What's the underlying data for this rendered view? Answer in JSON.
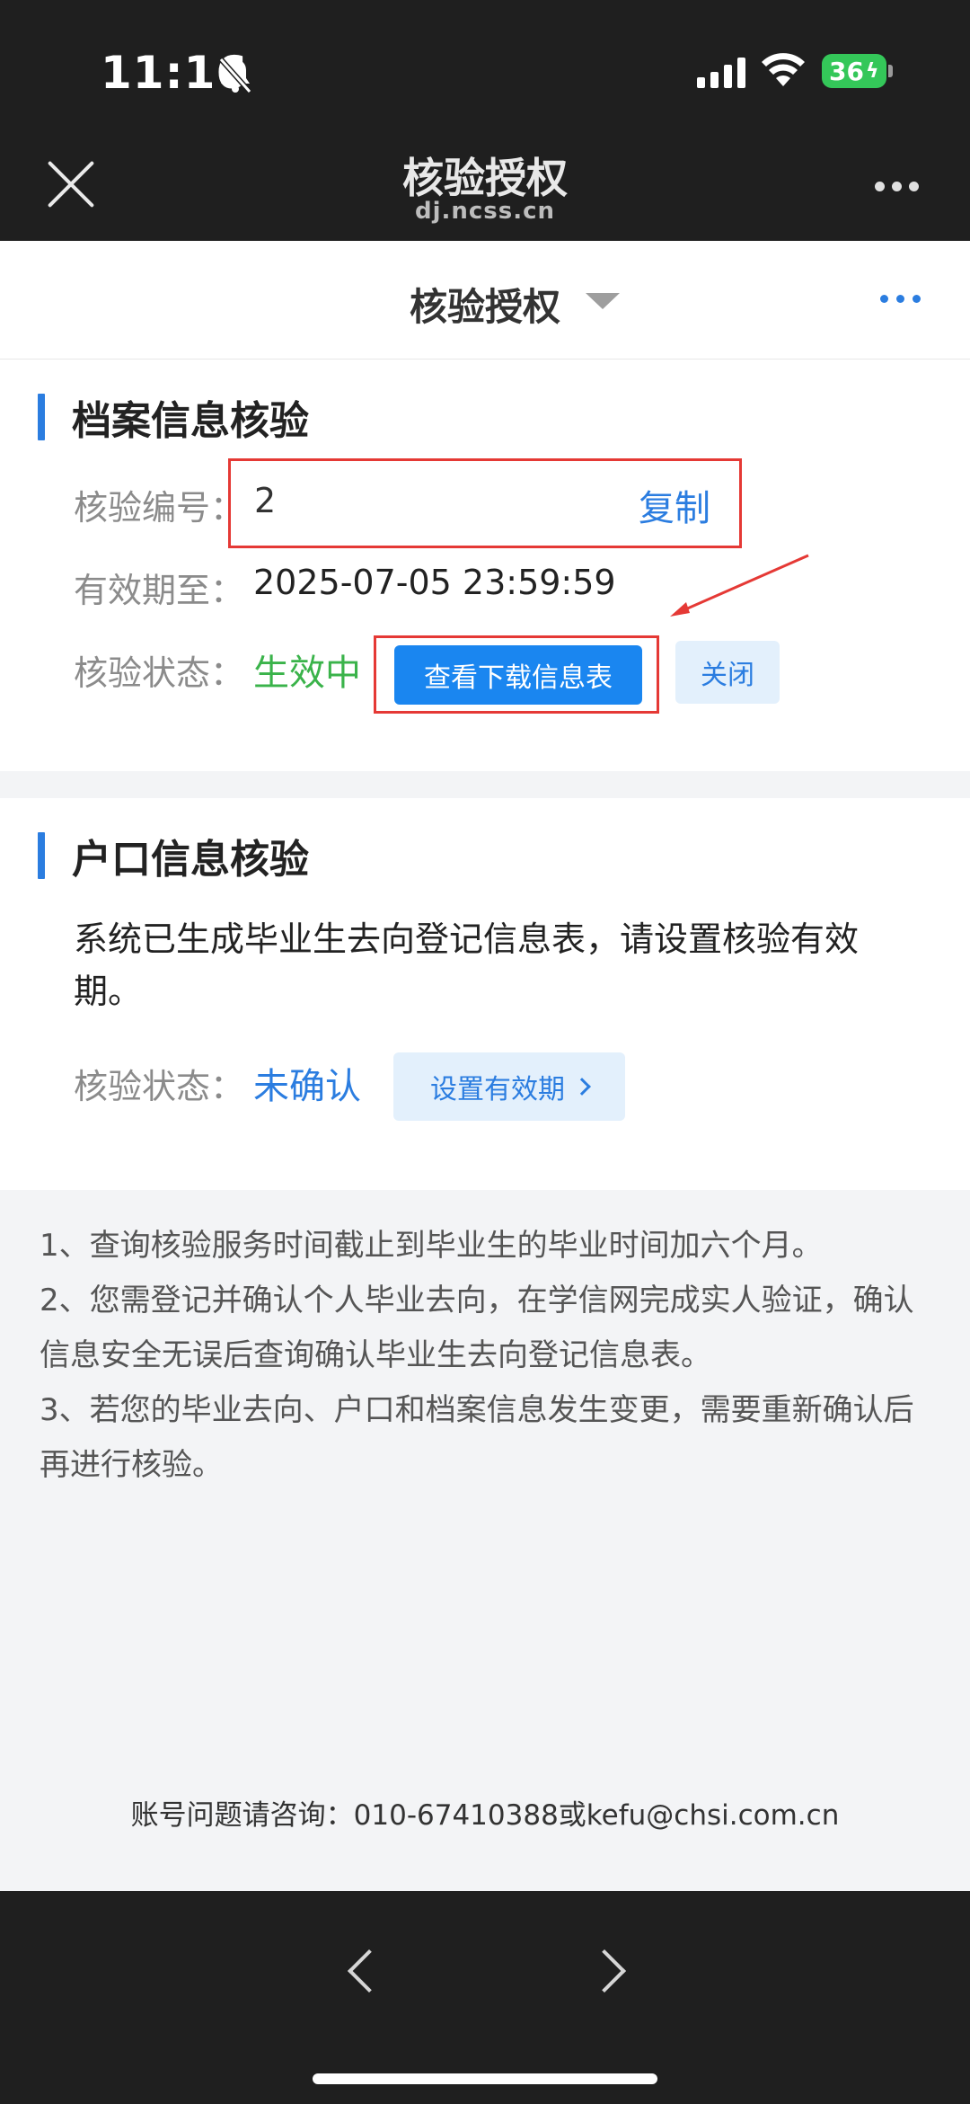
{
  "status_bar": {
    "time": "11:16",
    "battery": "36"
  },
  "window": {
    "title": "核验授权",
    "domain": "dj.ncss.cn"
  },
  "nav": {
    "title": "核验授权"
  },
  "archive": {
    "title": "档案信息核验",
    "code_label": "核验编号：",
    "code_value": "2",
    "copy_label": "复制",
    "expire_label": "有效期至：",
    "expire_value": "2025-07-05 23:59:59",
    "status_label": "核验状态：",
    "status_value": "生效中",
    "view_button": "查看下载信息表",
    "close_button": "关闭"
  },
  "hukou": {
    "title": "户口信息核验",
    "message": "系统已生成毕业生去向登记信息表，请设置核验有效期。",
    "status_label": "核验状态：",
    "status_value": "未确认",
    "set_button": "设置有效期"
  },
  "notes": [
    "1、查询核验服务时间截止到毕业生的毕业时间加六个月。",
    "2、您需登记并确认个人毕业去向，在学信网完成实人验证，确认信息安全无误后查询确认毕业生去向登记信息表。",
    "3、若您的毕业去向、户口和档案信息发生变更，需要重新确认后再进行核验。"
  ],
  "contact": "账号问题请咨询：010-67410388或kefu@chsi.com.cn",
  "colors": {
    "accent": "#2b7de0",
    "primary_button": "#1a86f0",
    "active_green": "#3ab34a",
    "highlight_red": "#e53935"
  }
}
